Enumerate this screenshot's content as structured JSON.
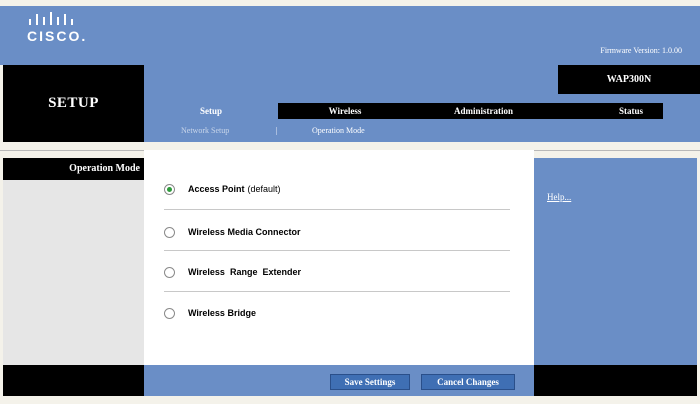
{
  "brand": {
    "logo_text": "CISCO.",
    "firmware": "Firmware Version: 1.0.00"
  },
  "left": {
    "section_title": "SETUP",
    "section_label": "Operation Mode"
  },
  "model": "WAP300N",
  "tabs": [
    {
      "label": "Setup",
      "active": true
    },
    {
      "label": "Wireless",
      "active": false
    },
    {
      "label": "Administration",
      "active": false
    },
    {
      "label": "Status",
      "active": false
    }
  ],
  "subnav": {
    "items": [
      "Network Setup",
      "Operation Mode"
    ],
    "separator": "|"
  },
  "modes": [
    {
      "label": "Access Point",
      "suffix": "(default)",
      "selected": true
    },
    {
      "label": "Wireless Media Connector",
      "suffix": "",
      "selected": false
    },
    {
      "label": "Wireless  Range  Extender",
      "suffix": "",
      "selected": false
    },
    {
      "label": "Wireless Bridge",
      "suffix": "",
      "selected": false
    }
  ],
  "help_link": "Help...",
  "buttons": {
    "save": "Save Settings",
    "cancel": "Cancel Changes"
  },
  "colors": {
    "accent_blue": "#6a8ec6",
    "selected_radio": "#2f9a3c"
  }
}
